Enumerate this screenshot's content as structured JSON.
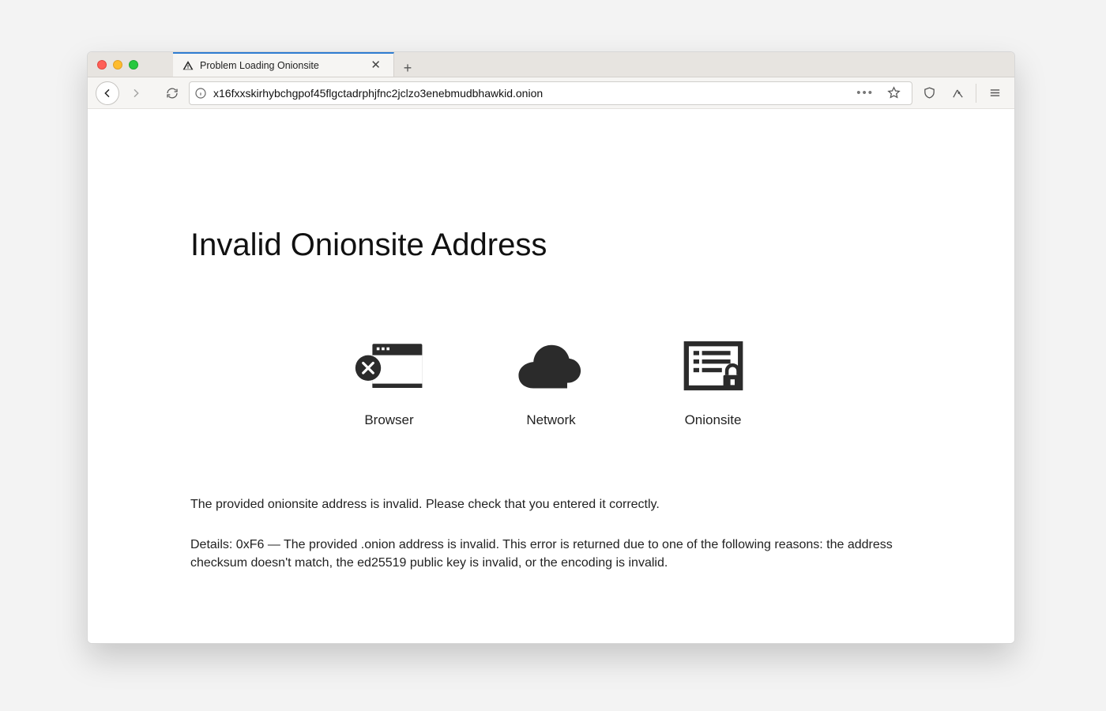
{
  "tab": {
    "title": "Problem Loading Onionsite"
  },
  "url": "x16fxxskirhybchgpof45flgctadrphjfnc2jclzo3enebmudbhawkid.onion",
  "page": {
    "heading": "Invalid Onionsite Address",
    "nodes": {
      "browser": "Browser",
      "network": "Network",
      "onionsite": "Onionsite"
    },
    "p1": "The provided onionsite address is invalid. Please check that you entered it correctly.",
    "p2": "Details: 0xF6 — The provided .onion address is invalid. This error is returned due to one of the following reasons: the address checksum doesn't match, the ed25519 public key is invalid, or the encoding is invalid."
  }
}
